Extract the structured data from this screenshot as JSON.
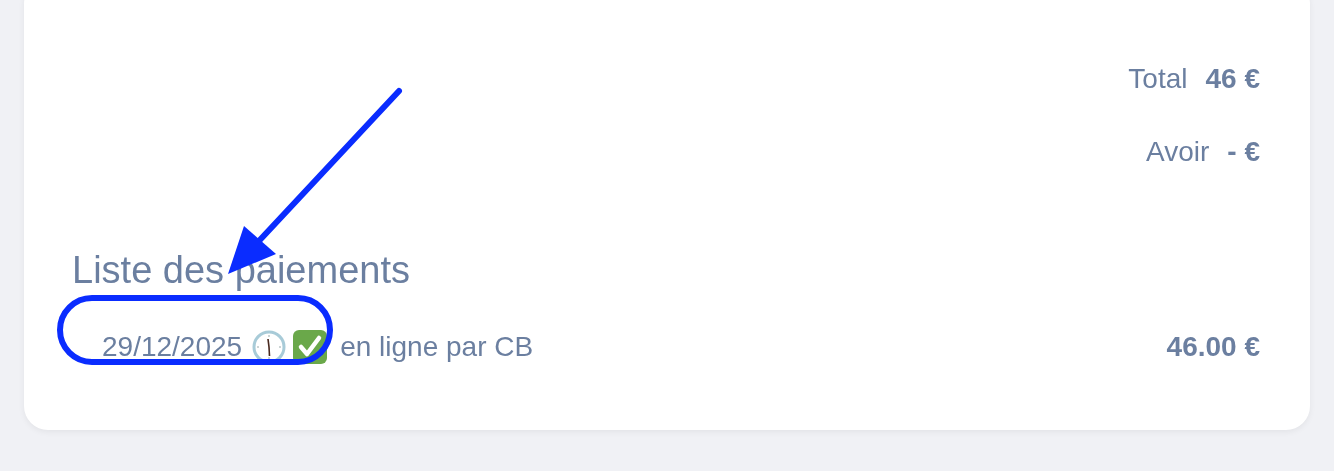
{
  "totals": [
    {
      "label": "Total",
      "value": "46 €"
    },
    {
      "label": "Avoir",
      "value": "- €"
    }
  ],
  "payments_heading": "Liste des paiements",
  "payments": [
    {
      "date": "29/12/2025",
      "paid": true,
      "method": "en ligne par CB",
      "amount": "46.00 €"
    }
  ],
  "annotation": {
    "kind": "arrow_and_ellipse"
  }
}
